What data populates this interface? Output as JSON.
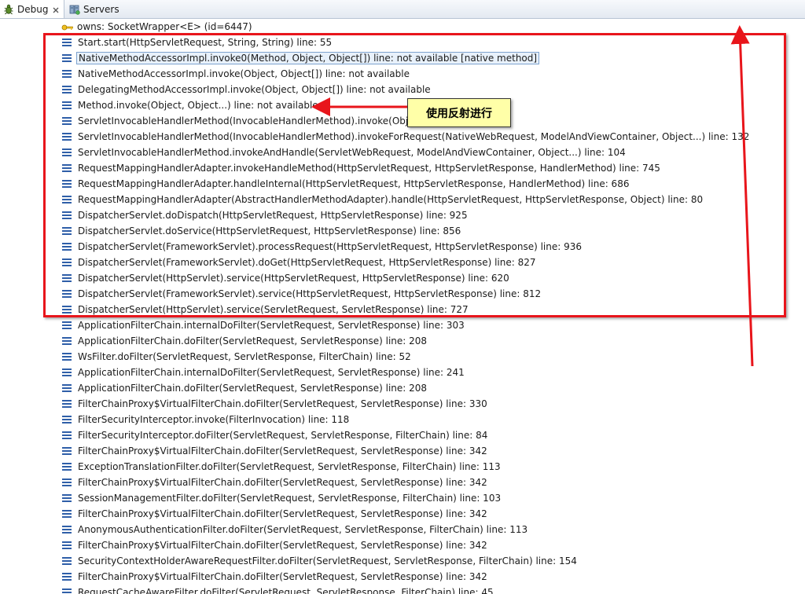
{
  "tabs": [
    {
      "label": "Debug",
      "icon": "debug-bug-icon",
      "active": true
    },
    {
      "label": "Servers",
      "icon": "servers-icon",
      "active": false
    }
  ],
  "owns_row": {
    "text": "owns: SocketWrapper<E>  (id=6447)",
    "icon": "key-icon"
  },
  "stack_frames": [
    "Start.start(HttpServletRequest, String, String) line: 55",
    "NativeMethodAccessorImpl.invoke0(Method, Object, Object[]) line: not available [native method]",
    "NativeMethodAccessorImpl.invoke(Object, Object[]) line: not available",
    "DelegatingMethodAccessorImpl.invoke(Object, Object[]) line: not available",
    "Method.invoke(Object, Object...) line: not available",
    "ServletInvocableHandlerMethod(InvocableHandlerMethod).invoke(Object...) line: 137",
    "ServletInvocableHandlerMethod(InvocableHandlerMethod).invokeForRequest(NativeWebRequest, ModelAndViewContainer, Object...) line: 132",
    "ServletInvocableHandlerMethod.invokeAndHandle(ServletWebRequest, ModelAndViewContainer, Object...) line: 104",
    "RequestMappingHandlerAdapter.invokeHandleMethod(HttpServletRequest, HttpServletResponse, HandlerMethod) line: 745",
    "RequestMappingHandlerAdapter.handleInternal(HttpServletRequest, HttpServletResponse, HandlerMethod) line: 686",
    "RequestMappingHandlerAdapter(AbstractHandlerMethodAdapter).handle(HttpServletRequest, HttpServletResponse, Object) line: 80",
    "DispatcherServlet.doDispatch(HttpServletRequest, HttpServletResponse) line: 925",
    "DispatcherServlet.doService(HttpServletRequest, HttpServletResponse) line: 856",
    "DispatcherServlet(FrameworkServlet).processRequest(HttpServletRequest, HttpServletResponse) line: 936",
    "DispatcherServlet(FrameworkServlet).doGet(HttpServletRequest, HttpServletResponse) line: 827",
    "DispatcherServlet(HttpServlet).service(HttpServletRequest, HttpServletResponse) line: 620",
    "DispatcherServlet(FrameworkServlet).service(HttpServletRequest, HttpServletResponse) line: 812",
    "DispatcherServlet(HttpServlet).service(ServletRequest, ServletResponse) line: 727",
    "ApplicationFilterChain.internalDoFilter(ServletRequest, ServletResponse) line: 303",
    "ApplicationFilterChain.doFilter(ServletRequest, ServletResponse) line: 208",
    "WsFilter.doFilter(ServletRequest, ServletResponse, FilterChain) line: 52",
    "ApplicationFilterChain.internalDoFilter(ServletRequest, ServletResponse) line: 241",
    "ApplicationFilterChain.doFilter(ServletRequest, ServletResponse) line: 208",
    "FilterChainProxy$VirtualFilterChain.doFilter(ServletRequest, ServletResponse) line: 330",
    "FilterSecurityInterceptor.invoke(FilterInvocation) line: 118",
    "FilterSecurityInterceptor.doFilter(ServletRequest, ServletResponse, FilterChain) line: 84",
    "FilterChainProxy$VirtualFilterChain.doFilter(ServletRequest, ServletResponse) line: 342",
    "ExceptionTranslationFilter.doFilter(ServletRequest, ServletResponse, FilterChain) line: 113",
    "FilterChainProxy$VirtualFilterChain.doFilter(ServletRequest, ServletResponse) line: 342",
    "SessionManagementFilter.doFilter(ServletRequest, ServletResponse, FilterChain) line: 103",
    "FilterChainProxy$VirtualFilterChain.doFilter(ServletRequest, ServletResponse) line: 342",
    "AnonymousAuthenticationFilter.doFilter(ServletRequest, ServletResponse, FilterChain) line: 113",
    "FilterChainProxy$VirtualFilterChain.doFilter(ServletRequest, ServletResponse) line: 342",
    "SecurityContextHolderAwareRequestFilter.doFilter(ServletRequest, ServletResponse, FilterChain) line: 154",
    "FilterChainProxy$VirtualFilterChain.doFilter(ServletRequest, ServletResponse) line: 342",
    "RequestCacheAwareFilter.doFilter(ServletRequest, ServletResponse, FilterChain) line: 45"
  ],
  "selected_frame_index": 1,
  "annotation": {
    "callout_text": "使用反射进行",
    "highlight_color": "#e8151b",
    "callout_bg": "#ffffa8"
  },
  "colors": {
    "frame_icon": "#2f5fa8",
    "tab_bar": "#e3e9f1",
    "selection_border": "#7da2ce"
  }
}
